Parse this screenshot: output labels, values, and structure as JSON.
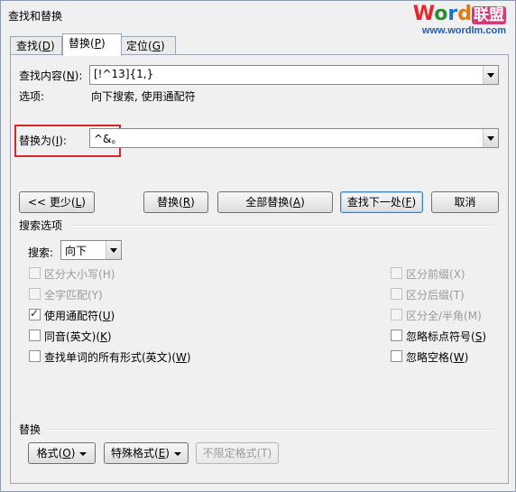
{
  "window": {
    "title": "查找和替换"
  },
  "logo": {
    "brand": "Word联盟",
    "url": "www.wordlm.com"
  },
  "tabs": [
    {
      "label": "查找(",
      "key": "D",
      "tail": ")"
    },
    {
      "label": "替换(",
      "key": "P",
      "tail": ")"
    },
    {
      "label": "定位(",
      "key": "G",
      "tail": ")"
    }
  ],
  "find": {
    "label_pre": "查找内容(",
    "key": "N",
    "label_post": "):",
    "value": "[!^13]{1,}"
  },
  "options": {
    "label": "选项:",
    "value": "向下搜索, 使用通配符"
  },
  "replace": {
    "label_pre": "替换为(",
    "key": "I",
    "label_post": "):",
    "value": "^&。"
  },
  "buttons": {
    "less": {
      "pre": "<< 更少(",
      "key": "L",
      "post": ")"
    },
    "replace": {
      "pre": "替换(",
      "key": "R",
      "post": ")"
    },
    "replace_all": {
      "pre": "全部替换(",
      "key": "A",
      "post": ")"
    },
    "find_next": {
      "pre": "查找下一处(",
      "key": "F",
      "post": ")"
    },
    "cancel": "取消"
  },
  "search_options": {
    "title": "搜索选项",
    "direction_label": "搜索:",
    "direction_value": "向下"
  },
  "checkboxes_left": [
    {
      "pre": "区分大小写(",
      "key": "H",
      "post": ")",
      "checked": false,
      "disabled": true
    },
    {
      "pre": "全字匹配(",
      "key": "Y",
      "post": ")",
      "checked": false,
      "disabled": true
    },
    {
      "pre": "使用通配符(",
      "key": "U",
      "post": ")",
      "checked": true,
      "disabled": false
    },
    {
      "pre": "同音(英文)(",
      "key": "K",
      "post": ")",
      "checked": false,
      "disabled": false
    },
    {
      "pre": "查找单词的所有形式(英文)(",
      "key": "W",
      "post": ")",
      "checked": false,
      "disabled": false
    }
  ],
  "checkboxes_right": [
    {
      "pre": "区分前缀(",
      "key": "X",
      "post": ")",
      "checked": false,
      "disabled": true
    },
    {
      "pre": "区分后缀(",
      "key": "T",
      "post": ")",
      "checked": false,
      "disabled": true
    },
    {
      "pre": "区分全/半角(",
      "key": "M",
      "post": ")",
      "checked": false,
      "disabled": true
    },
    {
      "pre": "忽略标点符号(",
      "key": "S",
      "post": ")",
      "checked": false,
      "disabled": false
    },
    {
      "pre": "忽略空格(",
      "key": "W",
      "post": ")",
      "checked": false,
      "disabled": false
    }
  ],
  "replace_section": {
    "title": "替换",
    "format": {
      "pre": "格式(",
      "key": "O",
      "post": ")"
    },
    "special": {
      "pre": "特殊格式(",
      "key": "E",
      "post": ")"
    },
    "no_format": {
      "pre": "不限定格式(",
      "key": "T",
      "post": ")"
    }
  }
}
